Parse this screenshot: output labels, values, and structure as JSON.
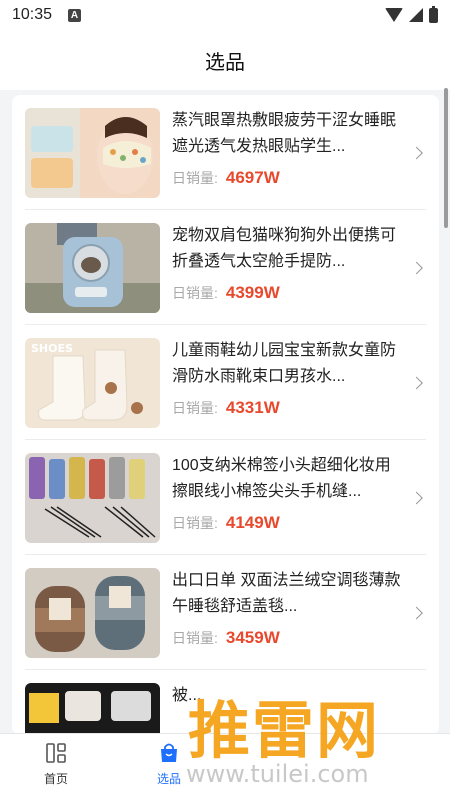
{
  "status_bar": {
    "time": "10:35",
    "notification_glyph": "A"
  },
  "header": {
    "title": "选品"
  },
  "items": [
    {
      "title": "蒸汽眼罩热敷眼疲劳干涩女睡眠遮光透气发热眼贴学生...",
      "sales_label": "日销量:",
      "sales_value": "4697W",
      "thumb": "eye-mask"
    },
    {
      "title": "宠物双肩包猫咪狗狗外出便携可折叠透气太空舱手提防...",
      "sales_label": "日销量:",
      "sales_value": "4399W",
      "thumb": "pet-backpack"
    },
    {
      "title": "儿童雨鞋幼儿园宝宝新款女童防滑防水雨靴束口男孩水...",
      "sales_label": "日销量:",
      "sales_value": "4331W",
      "thumb": "rain-boots",
      "thumb_text": "SHOES"
    },
    {
      "title": "100支纳米棉签小头超细化妆用擦眼线小棉签尖头手机缝...",
      "sales_label": "日销量:",
      "sales_value": "4149W",
      "thumb": "cotton-swabs"
    },
    {
      "title": "出口日单 双面法兰绒空调毯薄款午睡毯舒适盖毯...",
      "sales_label": "日销量:",
      "sales_value": "3459W",
      "thumb": "blanket"
    },
    {
      "title": "被...",
      "sales_label": "",
      "sales_value": "",
      "thumb": "bedding"
    }
  ],
  "tabbar": {
    "tabs": [
      {
        "label": "首页",
        "icon": "home-grid-icon",
        "active": false
      },
      {
        "label": "选品",
        "icon": "shopping-bag-icon",
        "active": true
      }
    ]
  },
  "watermark": {
    "text": "推雷网",
    "url": "www.tuilei.com"
  },
  "colors": {
    "accent": "#1f6fff",
    "price": "#e8492d",
    "watermark": "#f5a623"
  }
}
